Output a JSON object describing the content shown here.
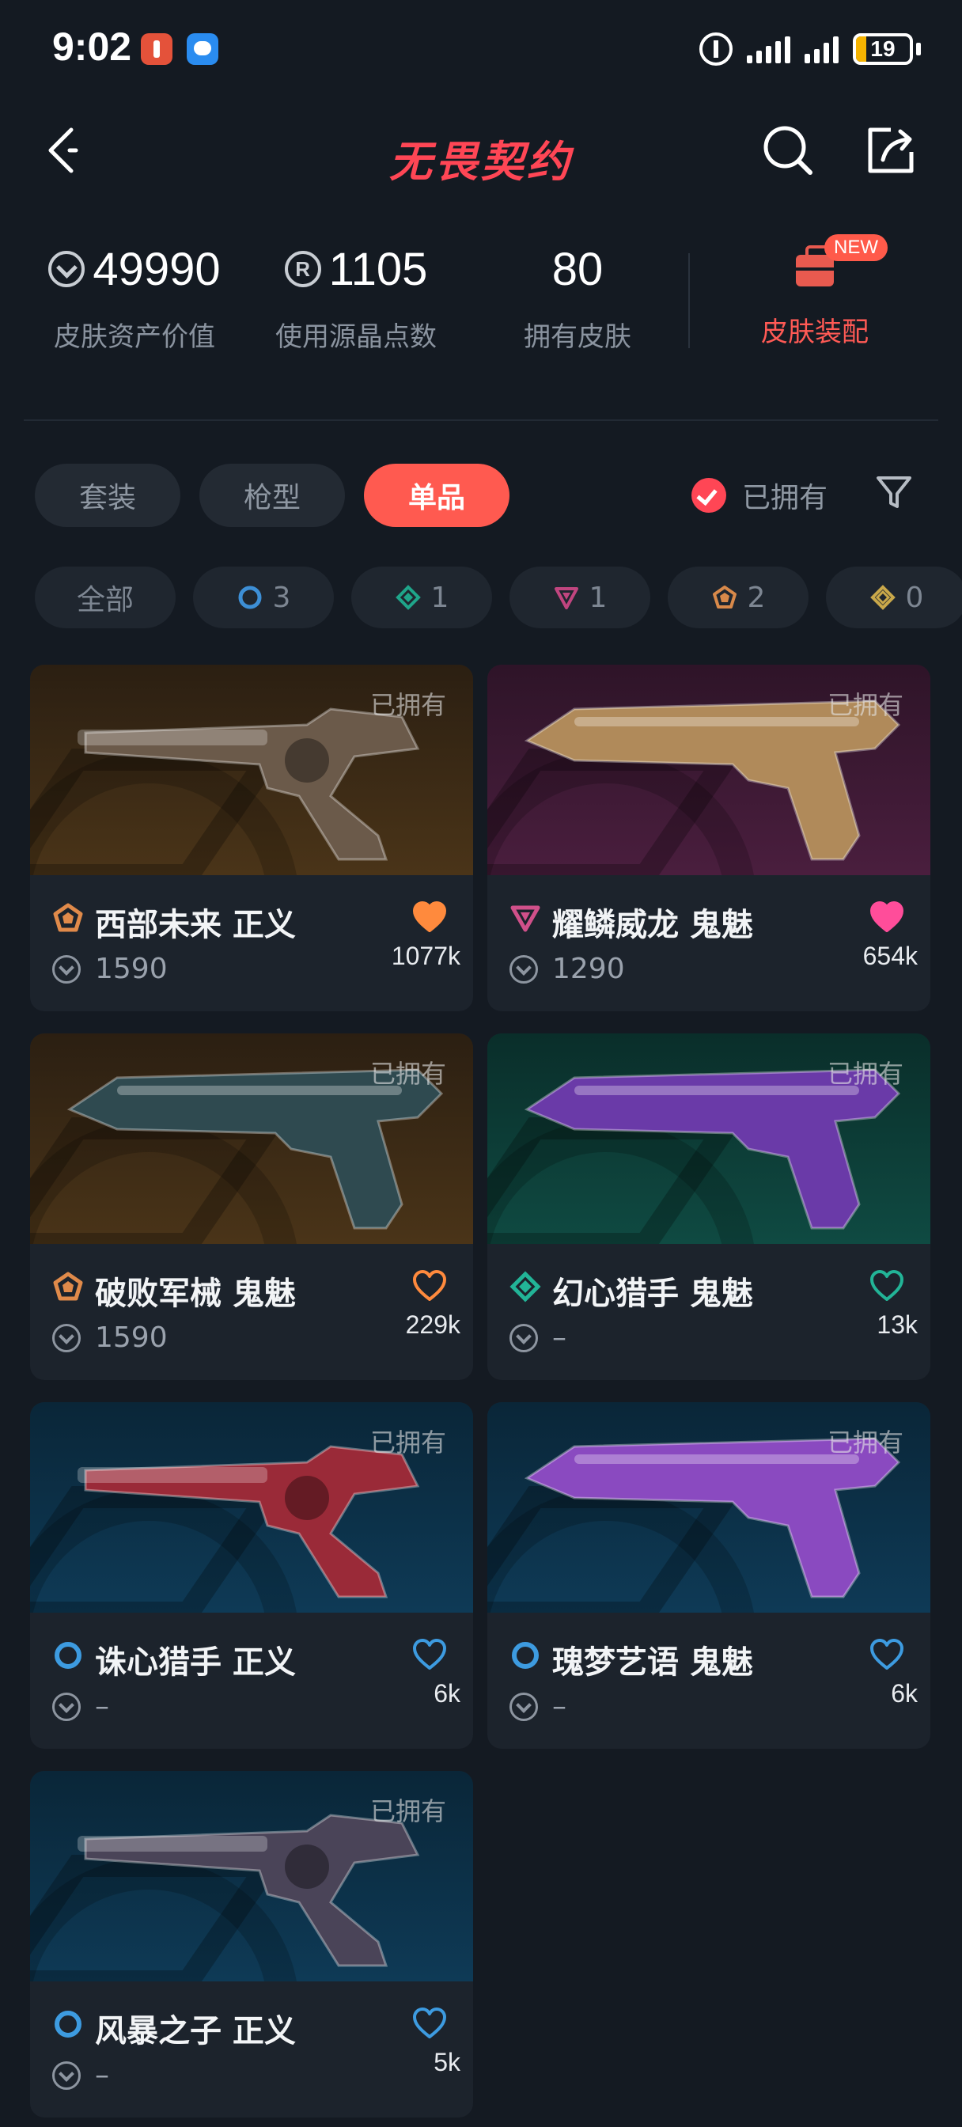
{
  "status_bar": {
    "time": "9:02",
    "battery": "19"
  },
  "header": {
    "title": "无畏契约"
  },
  "stats": {
    "asset_value": "49990",
    "asset_value_label": "皮肤资产价值",
    "rp_used": "1105",
    "rp_used_label": "使用源晶点数",
    "owned_count": "80",
    "owned_count_label": "拥有皮肤",
    "equip_label": "皮肤装配",
    "equip_badge": "NEW"
  },
  "tabs": [
    {
      "label": "套装",
      "active": false
    },
    {
      "label": "枪型",
      "active": false
    },
    {
      "label": "单品",
      "active": true
    }
  ],
  "owned_filter": {
    "label": "已拥有",
    "checked": true
  },
  "chips": [
    {
      "label": "全部"
    },
    {
      "count": "3",
      "tier": "select",
      "color": "#3d8fd6"
    },
    {
      "count": "1",
      "tier": "deluxe",
      "color": "#1fa58a"
    },
    {
      "count": "1",
      "tier": "premium",
      "color": "#c0457f"
    },
    {
      "count": "2",
      "tier": "exclusive",
      "color": "#d8894a"
    },
    {
      "count": "0",
      "tier": "ultra",
      "color": "#c9a84a"
    }
  ],
  "cards": [
    {
      "name": "西部未来 正义",
      "price": "1590",
      "likes": "1077k",
      "owned_tag": "已拥有",
      "tier": "exclusive",
      "tier_color": "#e08a4a",
      "heart_color": "#ff8a3d",
      "liked": true,
      "bg": "#4a3418",
      "bg2": "#2b1f12",
      "gun": "revolver",
      "gun_color": "#6b5a4a"
    },
    {
      "name": "耀鳞威龙 鬼魅",
      "price": "1290",
      "likes": "654k",
      "owned_tag": "已拥有",
      "tier": "premium",
      "tier_color": "#d0508a",
      "heart_color": "#ff4d9a",
      "liked": true,
      "bg": "#4a1e3e",
      "bg2": "#2e1428",
      "gun": "pistol",
      "gun_color": "#b08a5a"
    },
    {
      "name": "破败军械 鬼魅",
      "price": "1590",
      "likes": "229k",
      "owned_tag": "已拥有",
      "tier": "exclusive",
      "tier_color": "#e08a4a",
      "heart_color": "#ff8a3d",
      "liked": false,
      "bg": "#4a3418",
      "bg2": "#2b1f12",
      "gun": "pistol",
      "gun_color": "#2f4a50"
    },
    {
      "name": "幻心猎手 鬼魅",
      "price": "–",
      "likes": "13k",
      "owned_tag": "已拥有",
      "tier": "deluxe",
      "tier_color": "#22b497",
      "heart_color": "#22b497",
      "liked": false,
      "bg": "#0f4a42",
      "bg2": "#0a2e2a",
      "gun": "pistol",
      "gun_color": "#6a3aa8"
    },
    {
      "name": "诛心猎手 正义",
      "price": "–",
      "likes": "6k",
      "owned_tag": "已拥有",
      "tier": "select",
      "tier_color": "#3d9be0",
      "heart_color": "#3d9be0",
      "liked": false,
      "bg": "#0e3a56",
      "bg2": "#0a2638",
      "gun": "revolver",
      "gun_color": "#9a2a38"
    },
    {
      "name": "瑰梦艺语 鬼魅",
      "price": "–",
      "likes": "6k",
      "owned_tag": "已拥有",
      "tier": "select",
      "tier_color": "#3d9be0",
      "heart_color": "#3d9be0",
      "liked": false,
      "bg": "#0e3a56",
      "bg2": "#0a2638",
      "gun": "pistol",
      "gun_color": "#8a4ac0"
    },
    {
      "name": "风暴之子 正义",
      "price": "–",
      "likes": "5k",
      "owned_tag": "已拥有",
      "tier": "select",
      "tier_color": "#3d9be0",
      "heart_color": "#3d9be0",
      "liked": false,
      "bg": "#0e3a56",
      "bg2": "#0a2638",
      "gun": "revolver",
      "gun_color": "#4a4458"
    }
  ]
}
